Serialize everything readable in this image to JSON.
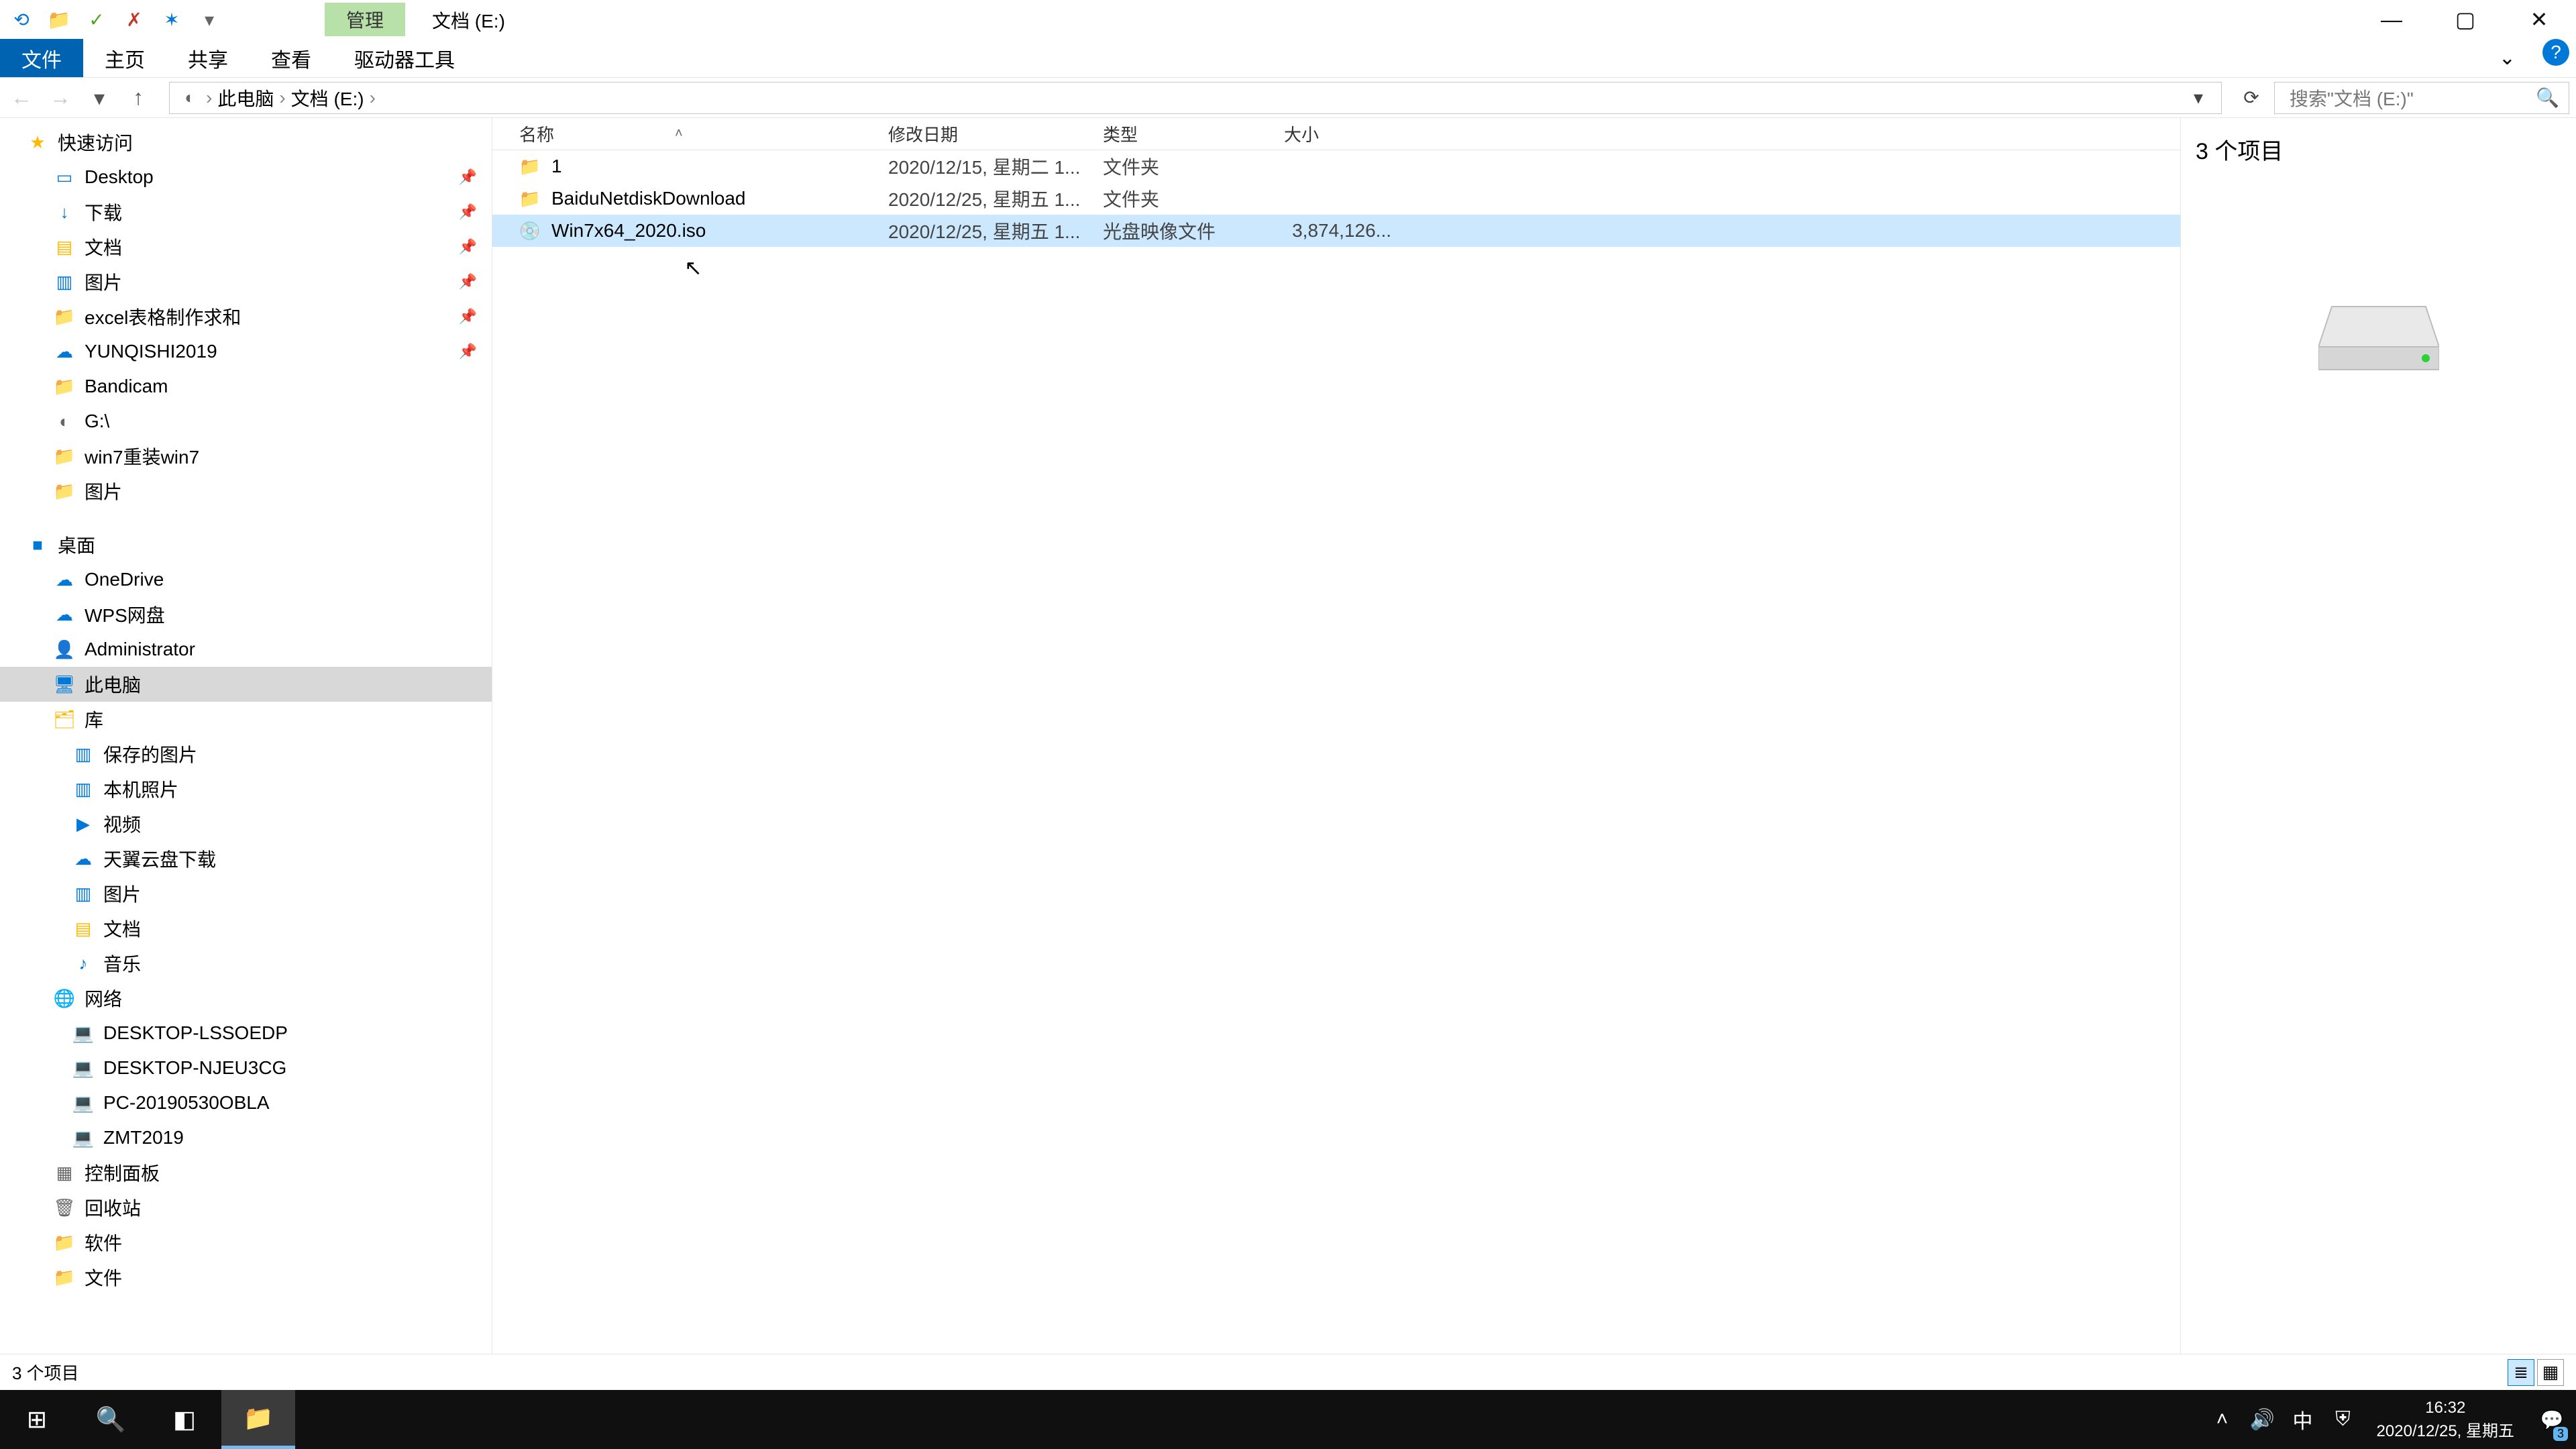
{
  "title": "文档 (E:)",
  "contextual_tab": "管理",
  "window_controls": {
    "help": "?"
  },
  "ribbon": {
    "file": "文件",
    "home": "主页",
    "share": "共享",
    "view": "查看",
    "drive_tools": "驱动器工具"
  },
  "breadcrumb": {
    "root": "此电脑",
    "loc": "文档 (E:)",
    "sep": "›"
  },
  "search": {
    "placeholder": "搜索\"文档 (E:)\""
  },
  "nav": [
    {
      "section": "★",
      "label": "快速访问",
      "icon": "star",
      "indent": 0
    },
    {
      "label": "Desktop",
      "icon": "desktop",
      "indent": 1,
      "pin": true
    },
    {
      "label": "下载",
      "icon": "download",
      "indent": 1,
      "pin": true
    },
    {
      "label": "文档",
      "icon": "doc",
      "indent": 1,
      "pin": true
    },
    {
      "label": "图片",
      "icon": "pic",
      "indent": 1,
      "pin": true
    },
    {
      "label": "excel表格制作求和",
      "icon": "folder",
      "indent": 1,
      "pin": true
    },
    {
      "label": "YUNQISHI2019",
      "icon": "cloud",
      "indent": 1,
      "pin": true
    },
    {
      "label": "Bandicam",
      "icon": "folder",
      "indent": 1
    },
    {
      "label": "G:\\",
      "icon": "drive",
      "indent": 1
    },
    {
      "label": "win7重装win7",
      "icon": "folder",
      "indent": 1
    },
    {
      "label": "图片",
      "icon": "folder",
      "indent": 1
    },
    {
      "label": "桌面",
      "icon": "squareblue",
      "spacer": true,
      "indent": 0
    },
    {
      "label": "OneDrive",
      "icon": "cloudblue",
      "indent": 1
    },
    {
      "label": "WPS网盘",
      "icon": "cloudblue",
      "indent": 1
    },
    {
      "label": "Administrator",
      "icon": "user",
      "indent": 1
    },
    {
      "label": "此电脑",
      "icon": "pc",
      "indent": 1,
      "selected": true
    },
    {
      "label": "库",
      "icon": "lib",
      "indent": 1
    },
    {
      "label": "保存的图片",
      "icon": "pic",
      "indent": 2
    },
    {
      "label": "本机照片",
      "icon": "pic",
      "indent": 2
    },
    {
      "label": "视频",
      "icon": "video",
      "indent": 2
    },
    {
      "label": "天翼云盘下载",
      "icon": "cloud",
      "indent": 2
    },
    {
      "label": "图片",
      "icon": "pic",
      "indent": 2
    },
    {
      "label": "文档",
      "icon": "doc",
      "indent": 2
    },
    {
      "label": "音乐",
      "icon": "music",
      "indent": 2
    },
    {
      "label": "网络",
      "icon": "net",
      "indent": 1
    },
    {
      "label": "DESKTOP-LSSOEDP",
      "icon": "nethost",
      "indent": 2
    },
    {
      "label": "DESKTOP-NJEU3CG",
      "icon": "nethost",
      "indent": 2
    },
    {
      "label": "PC-20190530OBLA",
      "icon": "nethost",
      "indent": 2
    },
    {
      "label": "ZMT2019",
      "icon": "nethost",
      "indent": 2
    },
    {
      "label": "控制面板",
      "icon": "panel",
      "indent": 1
    },
    {
      "label": "回收站",
      "icon": "bin",
      "indent": 1
    },
    {
      "label": "软件",
      "icon": "folder",
      "indent": 1
    },
    {
      "label": "文件",
      "icon": "folder",
      "indent": 1
    }
  ],
  "columns": {
    "name": "名称",
    "date": "修改日期",
    "type": "类型",
    "size": "大小"
  },
  "files": [
    {
      "name": "1",
      "date": "2020/12/15, 星期二 1...",
      "type": "文件夹",
      "size": "",
      "icon": "folder"
    },
    {
      "name": "BaiduNetdiskDownload",
      "date": "2020/12/25, 星期五 1...",
      "type": "文件夹",
      "size": "",
      "icon": "folder"
    },
    {
      "name": "Win7x64_2020.iso",
      "date": "2020/12/25, 星期五 1...",
      "type": "光盘映像文件",
      "size": "3,874,126...",
      "icon": "iso",
      "selected": true
    }
  ],
  "detail": {
    "count_label": "3 个项目"
  },
  "status": {
    "text": "3 个项目"
  },
  "taskbar": {
    "time": "16:32",
    "date": "2020/12/25, 星期五",
    "notif_count": "3",
    "ime": "中"
  },
  "icon_chars": {
    "star": "★",
    "desktop": "▭",
    "download": "↓",
    "doc": "▤",
    "pic": "▥",
    "folder": "📁",
    "cloud": "☁",
    "drive": "◐",
    "squareblue": "■",
    "cloudblue": "☁",
    "user": "👤",
    "pc": "🖥",
    "lib": "🗂",
    "video": "▶",
    "music": "♪",
    "net": "🌐",
    "nethost": "💻",
    "panel": "▦",
    "bin": "🗑",
    "iso": "💿",
    "check": "✓",
    "uncheck": "✗",
    "qstar": "✶",
    "qdrop": "▾",
    "back": "←",
    "fwd": "→",
    "up": "↑",
    "refresh": "⟳",
    "search": "🔍",
    "cd": "▾",
    "min": "—",
    "max": "▢",
    "close": "✕",
    "chevdn": "⌄",
    "pin": "📌",
    "winstart": "⊞",
    "tasksearch": "🔍",
    "taskview": "◧",
    "explorer": "📁",
    "trayup": "˄",
    "sound": "🔊",
    "notif": "💬",
    "sort": "˄"
  }
}
